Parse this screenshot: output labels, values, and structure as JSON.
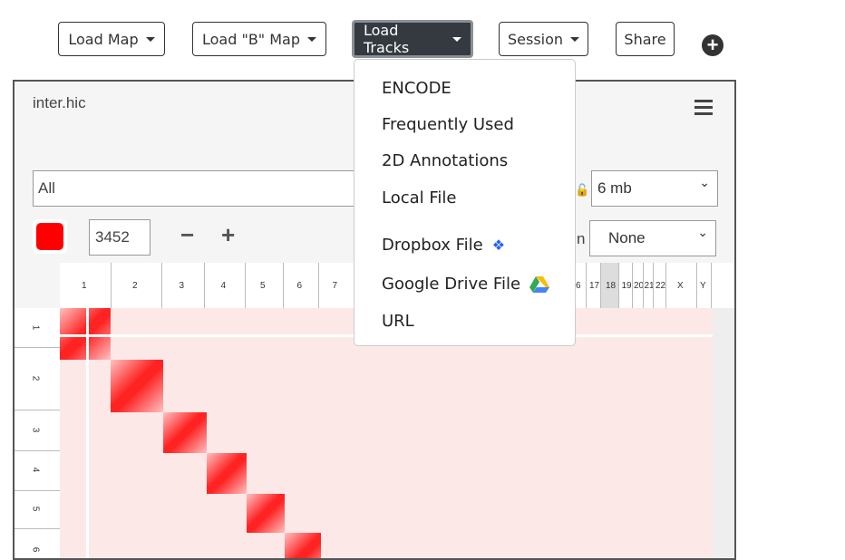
{
  "toolbar": {
    "load_map": "Load Map",
    "load_b_map": "Load \"B\" Map",
    "load_tracks": "Load Tracks",
    "session": "Session",
    "share": "Share",
    "add": "+"
  },
  "panel": {
    "title": "inter.hic",
    "locus": "All",
    "resolution": "6 mb",
    "normalization": "None",
    "norm_label_partial": "n",
    "color": "#ff0000",
    "threshold": "3452",
    "minus": "−",
    "plus": "+"
  },
  "chromosomes": [
    "1",
    "2",
    "3",
    "4",
    "5",
    "6",
    "7",
    "6",
    "17",
    "18",
    "19",
    "20",
    "21",
    "22",
    "X",
    "Y"
  ],
  "left_chromosomes": [
    "1",
    "2",
    "3",
    "4",
    "5",
    "6"
  ],
  "menu": {
    "items": [
      "ENCODE",
      "Frequently Used",
      "2D Annotations",
      "Local File",
      "Dropbox File",
      "Google Drive File",
      "URL"
    ]
  }
}
